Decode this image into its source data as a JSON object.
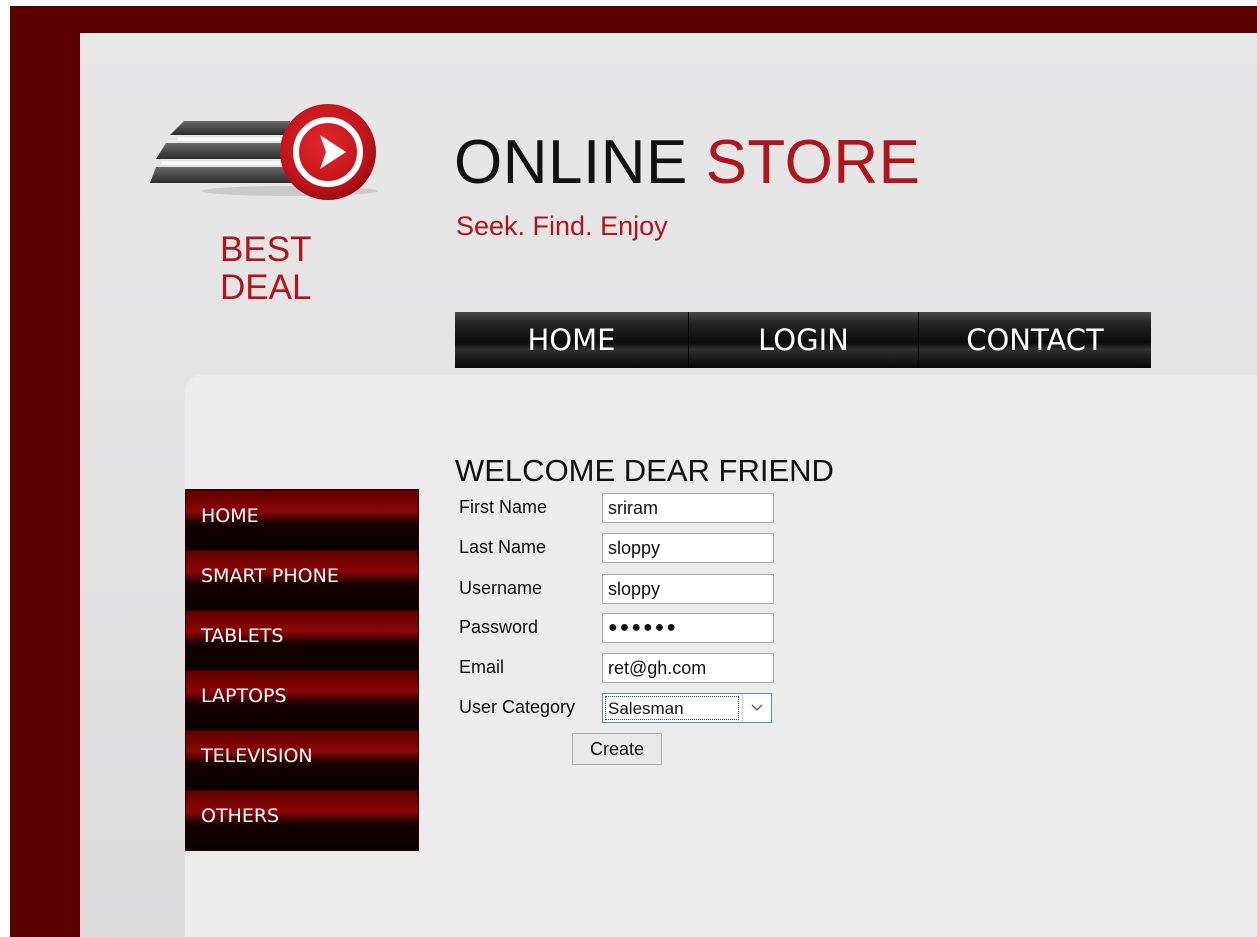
{
  "brand": {
    "logo_line1": "BEST",
    "logo_line2": "DEAL",
    "title_part1": "ONLINE",
    "title_part2": "STORE",
    "tagline": "Seek. Find. Enjoy"
  },
  "topnav": {
    "items": [
      {
        "label": "HOME"
      },
      {
        "label": "LOGIN"
      },
      {
        "label": "CONTACT"
      }
    ]
  },
  "sidebar": {
    "items": [
      {
        "label": "HOME"
      },
      {
        "label": "SMART PHONE"
      },
      {
        "label": "TABLETS"
      },
      {
        "label": "LAPTOPS"
      },
      {
        "label": "TELEVISION"
      },
      {
        "label": "OTHERS"
      }
    ]
  },
  "form": {
    "title": "WELCOME DEAR FRIEND",
    "first_name": {
      "label": "First Name",
      "value": "sriram"
    },
    "last_name": {
      "label": "Last Name",
      "value": "sloppy"
    },
    "username": {
      "label": "Username",
      "value": "sloppy"
    },
    "password": {
      "label": "Password",
      "value": "●●●●●●"
    },
    "email": {
      "label": "Email",
      "value": "ret@gh.com"
    },
    "user_category": {
      "label": "User Category",
      "selected": "Salesman"
    },
    "submit_label": "Create"
  },
  "icons": {
    "logo": "play-speed-icon",
    "select_arrow": "chevron-down-icon"
  },
  "colors": {
    "frame": "#5a0000",
    "brand_red": "#b0151c",
    "nav_dark": "#0b0b0b"
  }
}
